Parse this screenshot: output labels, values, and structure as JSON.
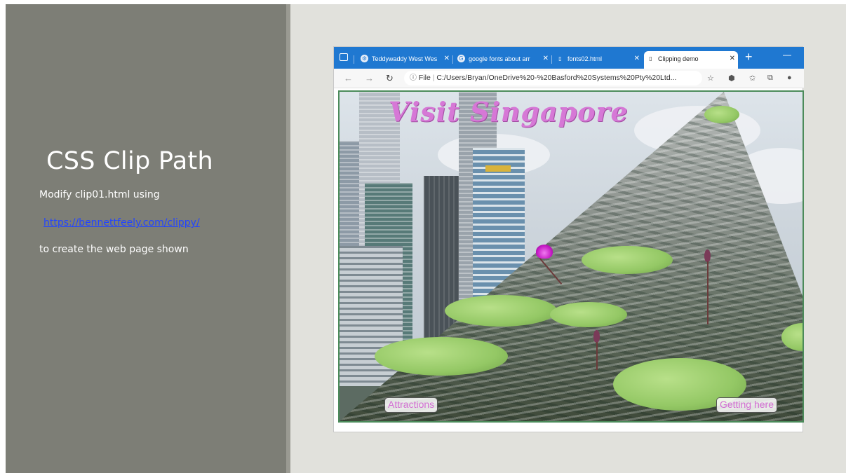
{
  "slide": {
    "title": "CSS Clip Path",
    "line1": "Modify clip01.html using",
    "link": "https://bennettfeely.com/clippy/",
    "line3": "to create the web page shown"
  },
  "browser": {
    "tabs": [
      {
        "label": "Teddywaddy West Wes",
        "icon": "gear-icon"
      },
      {
        "label": "google fonts about arr",
        "icon": "google-icon"
      },
      {
        "label": "fonts02.html",
        "icon": "document-icon"
      },
      {
        "label": "Clipping demo",
        "icon": "document-icon",
        "active": true
      }
    ],
    "url_prefix": "File",
    "url": "C:/Users/Bryan/OneDrive%20-%20Basford%20Systems%20Pty%20Ltd..."
  },
  "page": {
    "title": "Visit Singapore",
    "btn_left": "Attractions",
    "btn_right": "Getting here"
  },
  "colors": {
    "left_panel": "#7d7e76",
    "tabbar": "#1f78d1",
    "title_pink": "#d678d6"
  }
}
